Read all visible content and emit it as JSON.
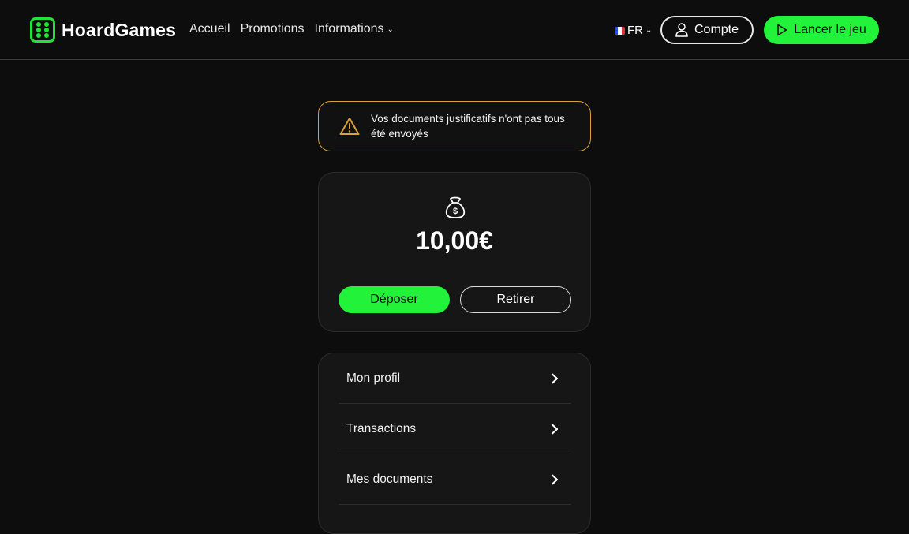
{
  "brand": {
    "name": "HoardGames",
    "accent": "#22f23a"
  },
  "nav": {
    "home": "Accueil",
    "promotions": "Promotions",
    "info": "Informations"
  },
  "language": {
    "code": "FR"
  },
  "header_buttons": {
    "account": "Compte",
    "play": "Lancer le jeu"
  },
  "warning": {
    "line1": "Vos documents justificatifs n'ont pas tous",
    "line2": "été envoyés",
    "color": "#d7a23a"
  },
  "balance": {
    "amount": "10,00€",
    "deposit": "Déposer",
    "withdraw": "Retirer"
  },
  "menu": {
    "items": [
      {
        "label": "Mon profil"
      },
      {
        "label": "Transactions"
      },
      {
        "label": "Mes documents"
      }
    ]
  }
}
